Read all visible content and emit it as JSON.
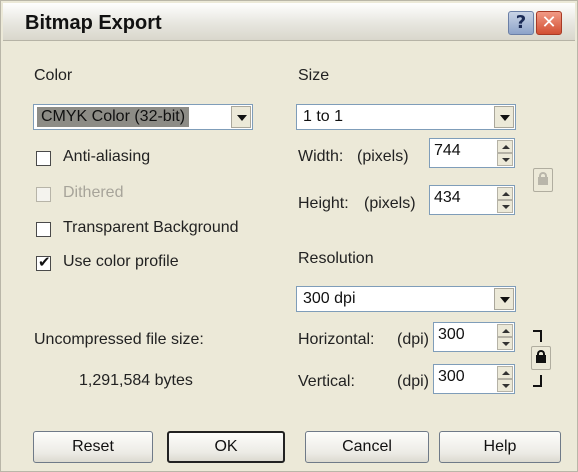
{
  "window": {
    "title": "Bitmap Export",
    "help_glyph": "?",
    "close_glyph": "✕"
  },
  "color": {
    "label": "Color",
    "mode_value": "CMYK Color (32-bit)",
    "options": [
      {
        "label": "Anti-aliasing",
        "checked": false,
        "enabled": true
      },
      {
        "label": "Dithered",
        "checked": false,
        "enabled": false
      },
      {
        "label": "Transparent Background",
        "checked": false,
        "enabled": true
      },
      {
        "label": "Use color profile",
        "checked": true,
        "enabled": true
      }
    ]
  },
  "size": {
    "label": "Size",
    "preset_value": "1 to 1",
    "width_label": "Width:",
    "height_label": "Height:",
    "unit_label": "(pixels)",
    "width_value": "744",
    "height_value": "434"
  },
  "resolution": {
    "label": "Resolution",
    "preset_value": "300 dpi",
    "horizontal_label": "Horizontal:",
    "vertical_label": "Vertical:",
    "unit_label": "(dpi)",
    "horizontal_value": "300",
    "vertical_value": "300"
  },
  "file_size": {
    "label": "Uncompressed file size:",
    "value": "1,291,584 bytes"
  },
  "buttons": {
    "reset": "Reset",
    "ok": "OK",
    "cancel": "Cancel",
    "help": "Help"
  },
  "check_glyph": "✔"
}
